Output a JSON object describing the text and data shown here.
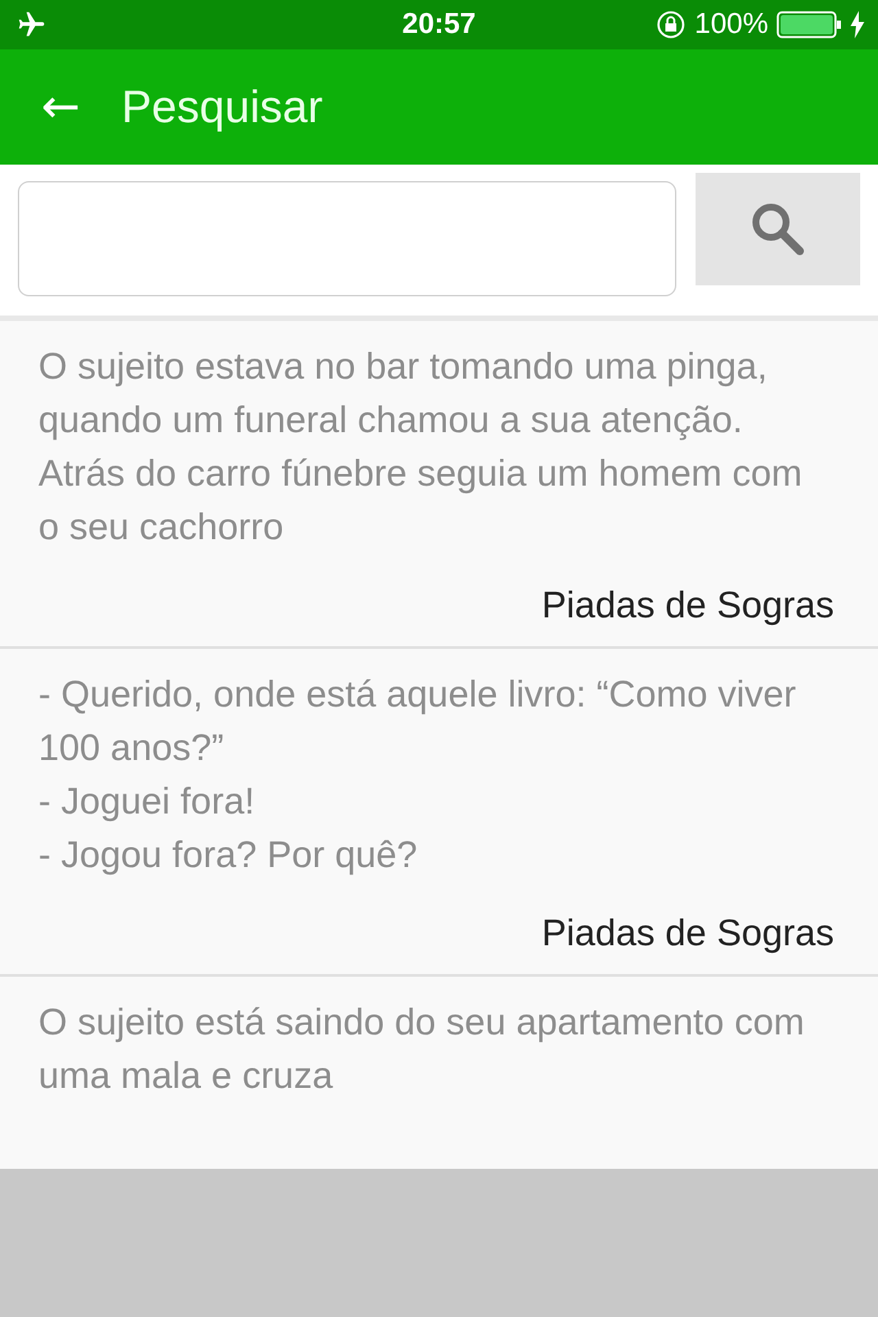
{
  "status_bar": {
    "time": "20:57",
    "battery": "100%"
  },
  "app_bar": {
    "back": "←",
    "title": "Pesquisar"
  },
  "jokes": [
    {
      "text": "O sujeito estava no bar tomando uma pinga, quando um funeral chamou a sua atenção. Atrás do carro fúnebre seguia um homem com o seu cachorro",
      "category": "Piadas de Sogras"
    },
    {
      "text": "- Querido, onde está aquele livro: “Como viver 100 anos?”\n- Joguei fora!\n- Jogou fora? Por quê?",
      "category": "Piadas de Sogras"
    },
    {
      "text": "O sujeito está saindo do seu apartamento com uma mala e cruza"
    }
  ]
}
